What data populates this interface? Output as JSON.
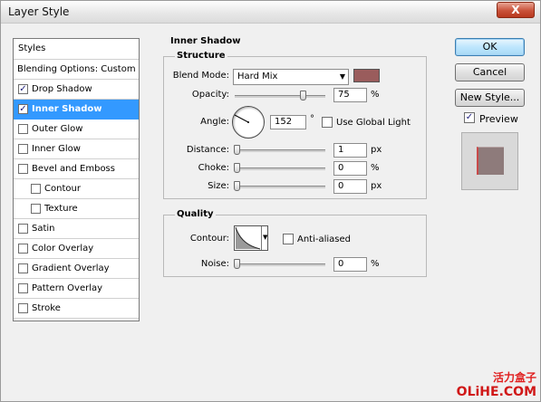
{
  "window": {
    "title": "Layer Style",
    "close_label": "X"
  },
  "sidebar": {
    "header": "Styles",
    "blending": "Blending Options: Custom",
    "items": [
      {
        "label": "Drop Shadow",
        "checked": true,
        "selected": false,
        "indent": false
      },
      {
        "label": "Inner Shadow",
        "checked": true,
        "selected": true,
        "indent": false
      },
      {
        "label": "Outer Glow",
        "checked": false,
        "selected": false,
        "indent": false
      },
      {
        "label": "Inner Glow",
        "checked": false,
        "selected": false,
        "indent": false
      },
      {
        "label": "Bevel and Emboss",
        "checked": false,
        "selected": false,
        "indent": false
      },
      {
        "label": "Contour",
        "checked": false,
        "selected": false,
        "indent": true
      },
      {
        "label": "Texture",
        "checked": false,
        "selected": false,
        "indent": true
      },
      {
        "label": "Satin",
        "checked": false,
        "selected": false,
        "indent": false
      },
      {
        "label": "Color Overlay",
        "checked": false,
        "selected": false,
        "indent": false
      },
      {
        "label": "Gradient Overlay",
        "checked": false,
        "selected": false,
        "indent": false
      },
      {
        "label": "Pattern Overlay",
        "checked": false,
        "selected": false,
        "indent": false
      },
      {
        "label": "Stroke",
        "checked": false,
        "selected": false,
        "indent": false
      }
    ]
  },
  "panel": {
    "section_title": "Inner Shadow",
    "structure": {
      "title": "Structure",
      "blend_mode_label": "Blend Mode:",
      "blend_mode_value": "Hard Mix",
      "shadow_color": "#9a5c5c",
      "opacity_label": "Opacity:",
      "opacity_value": "75",
      "opacity_unit": "%",
      "opacity_level": 0.75,
      "angle_label": "Angle:",
      "angle_value": "152",
      "angle_unit": "°",
      "global_light_label": "Use Global Light",
      "global_light_checked": false,
      "distance_label": "Distance:",
      "distance_value": "1",
      "distance_unit": "px",
      "choke_label": "Choke:",
      "choke_value": "0",
      "choke_unit": "%",
      "size_label": "Size:",
      "size_value": "0",
      "size_unit": "px"
    },
    "quality": {
      "title": "Quality",
      "contour_label": "Contour:",
      "anti_aliased_label": "Anti-aliased",
      "anti_aliased_checked": false,
      "noise_label": "Noise:",
      "noise_value": "0",
      "noise_unit": "%"
    }
  },
  "buttons": {
    "ok": "OK",
    "cancel": "Cancel",
    "new_style": "New Style...",
    "preview_label": "Preview",
    "preview_checked": true
  },
  "watermark": {
    "line1": "活力盒子",
    "line2": "OLiHE.COM"
  }
}
